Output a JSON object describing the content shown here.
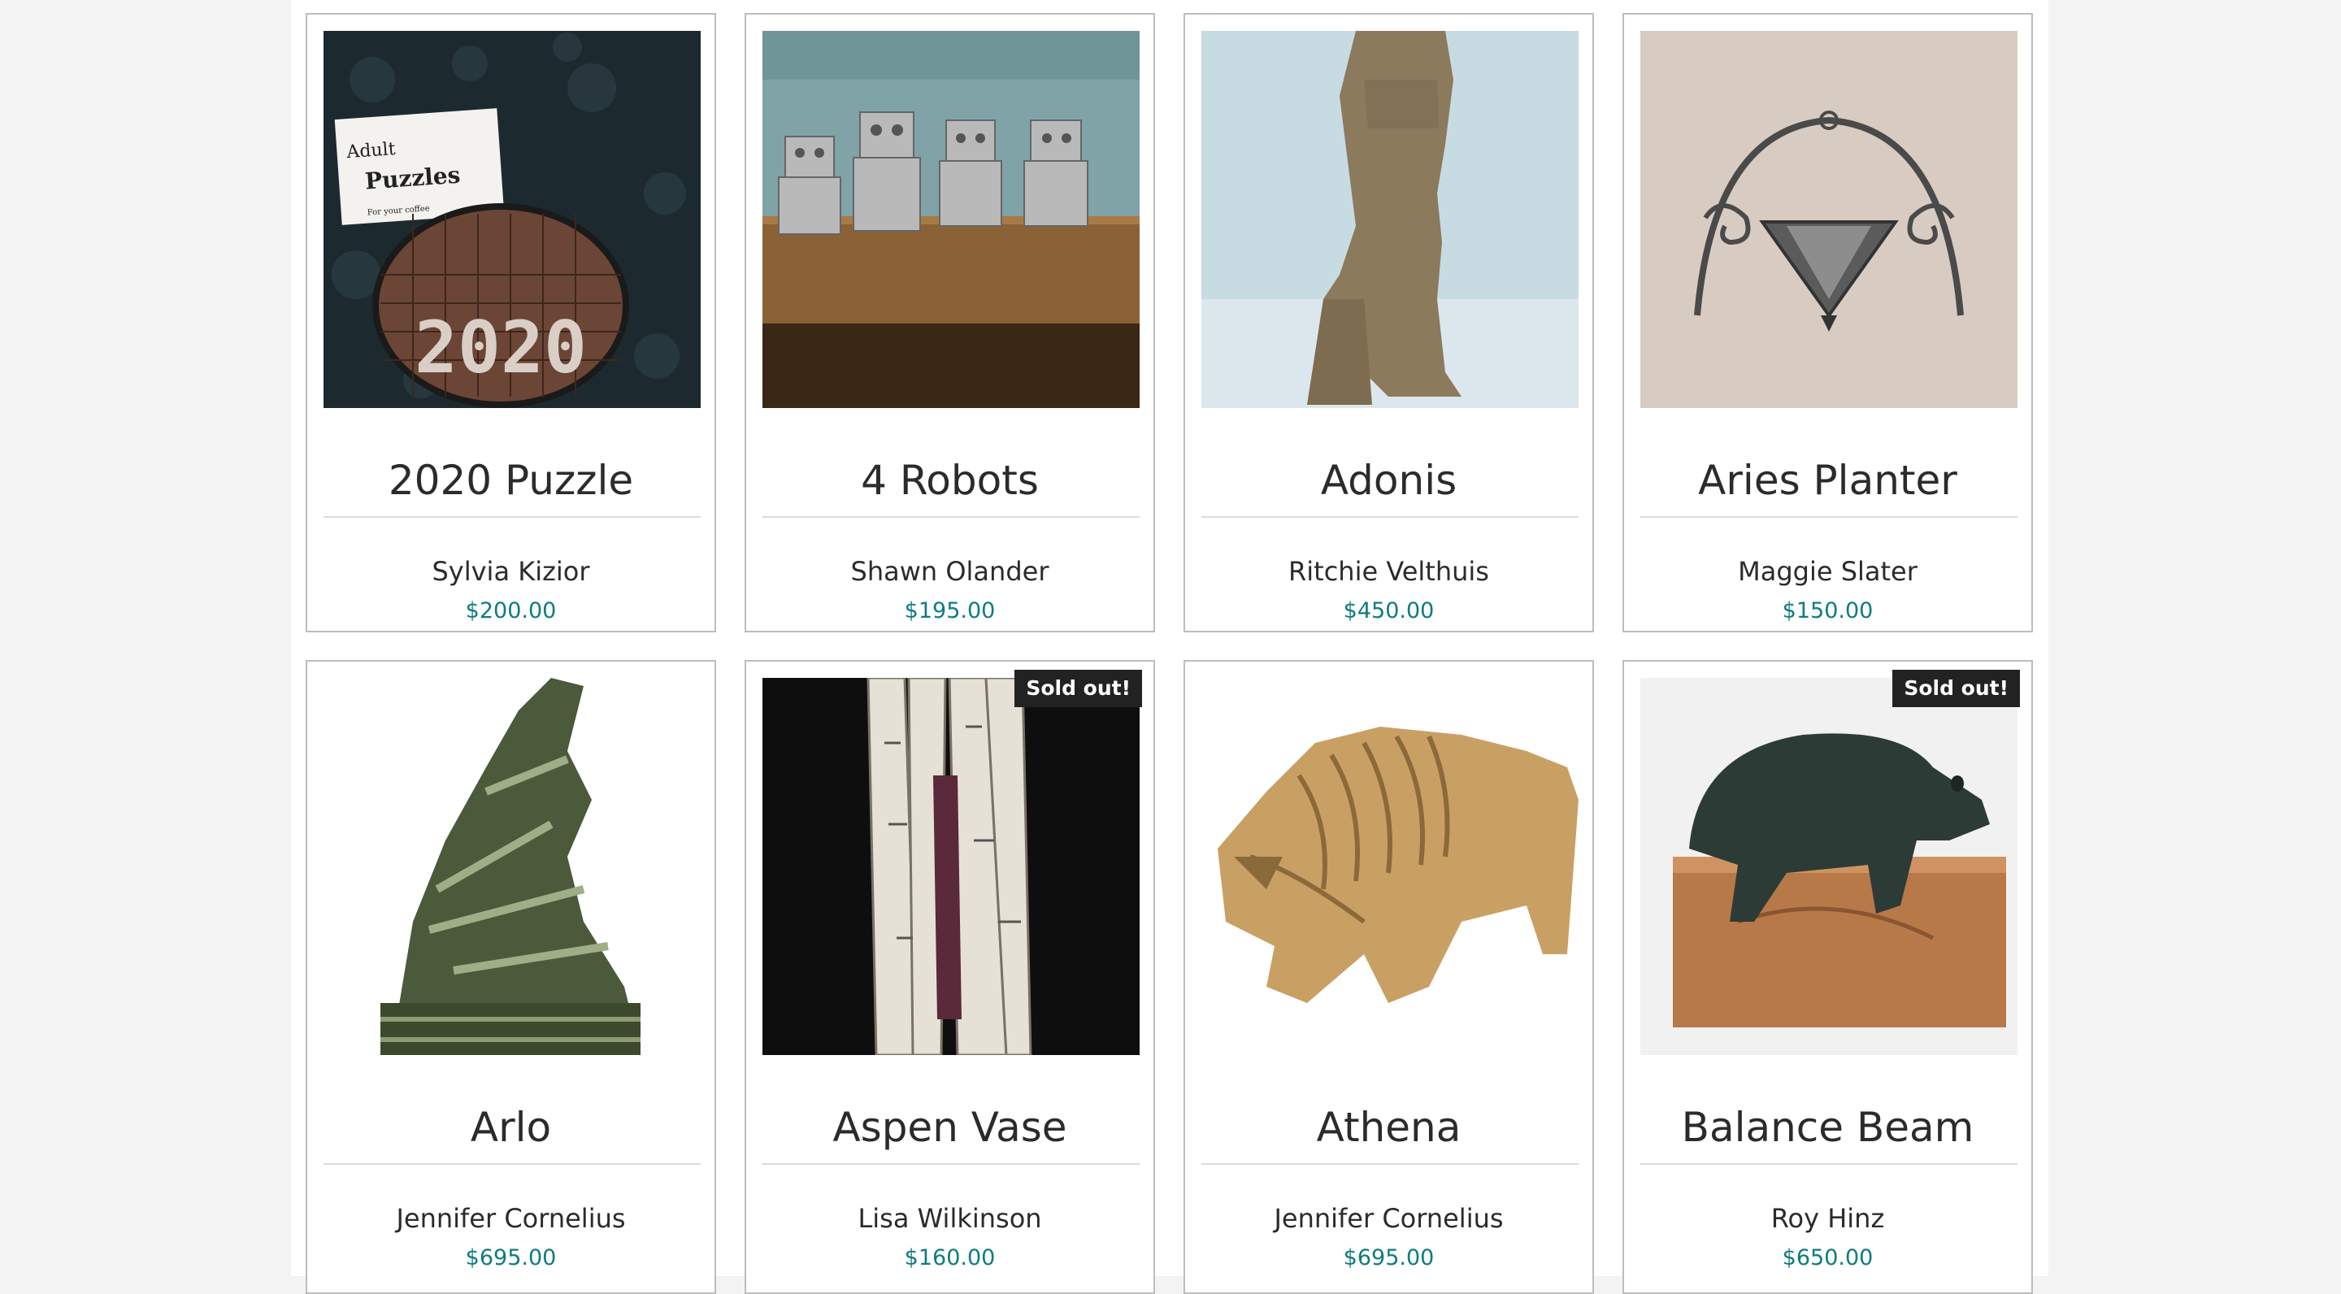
{
  "theme": {
    "price_color": "#0e7c80",
    "sold_badge_bg": "#222222"
  },
  "products": [
    {
      "title": "2020 Puzzle",
      "artist": "Sylvia Kizior",
      "price": "$200.00",
      "sold_out": false,
      "image_icon": "puzzle-image"
    },
    {
      "title": "4 Robots",
      "artist": "Shawn Olander",
      "price": "$195.00",
      "sold_out": false,
      "image_icon": "robots-image"
    },
    {
      "title": "Adonis",
      "artist": "Ritchie Velthuis",
      "price": "$450.00",
      "sold_out": false,
      "image_icon": "statue-image"
    },
    {
      "title": "Aries Planter",
      "artist": "Maggie Slater",
      "price": "$150.00",
      "sold_out": false,
      "image_icon": "planter-image"
    },
    {
      "title": "Arlo",
      "artist": "Jennifer Cornelius",
      "price": "$695.00",
      "sold_out": false,
      "image_icon": "stone-carving-image"
    },
    {
      "title": "Aspen Vase",
      "artist": "Lisa Wilkinson",
      "price": "$160.00",
      "sold_out": true,
      "sold_label": "Sold out!",
      "image_icon": "vase-image"
    },
    {
      "title": "Athena",
      "artist": "Jennifer Cornelius",
      "price": "$695.00",
      "sold_out": false,
      "image_icon": "bison-carving-image"
    },
    {
      "title": "Balance Beam",
      "artist": "Roy Hinz",
      "price": "$650.00",
      "sold_out": true,
      "sold_label": "Sold out!",
      "image_icon": "bear-carving-image"
    }
  ],
  "puzzle_sign": {
    "line1": "Adult",
    "line2": "Puzzles",
    "line3": "For your coffee",
    "tiles_text": "2020"
  }
}
